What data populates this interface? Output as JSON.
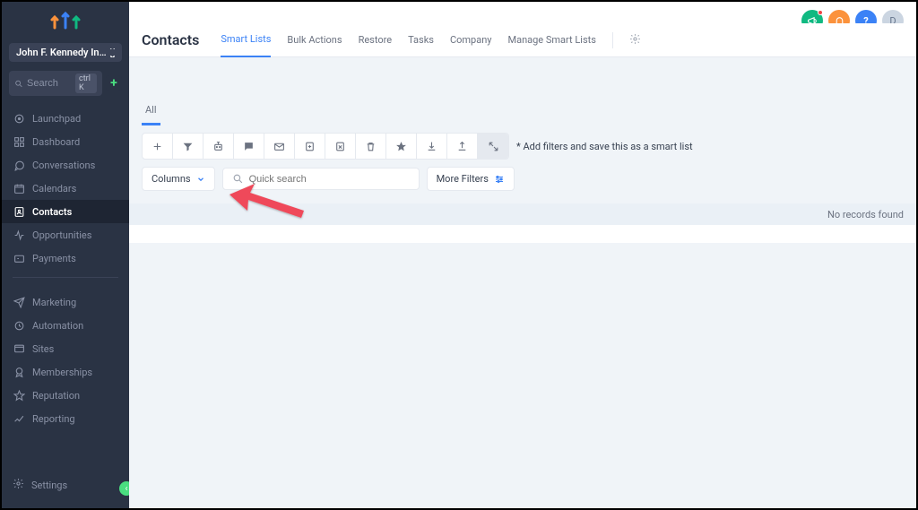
{
  "org": {
    "name": "John F. Kennedy Internati..."
  },
  "search": {
    "placeholder": "Search",
    "kbd": "ctrl K"
  },
  "sidebar": {
    "group1": [
      {
        "label": "Launchpad"
      },
      {
        "label": "Dashboard"
      },
      {
        "label": "Conversations"
      },
      {
        "label": "Calendars"
      },
      {
        "label": "Contacts"
      },
      {
        "label": "Opportunities"
      },
      {
        "label": "Payments"
      }
    ],
    "group2": [
      {
        "label": "Marketing"
      },
      {
        "label": "Automation"
      },
      {
        "label": "Sites"
      },
      {
        "label": "Memberships"
      },
      {
        "label": "Reputation"
      },
      {
        "label": "Reporting"
      }
    ],
    "settings": "Settings"
  },
  "topicons": {
    "avatar_initial": "D"
  },
  "page": {
    "title": "Contacts"
  },
  "subnav": [
    "Smart Lists",
    "Bulk Actions",
    "Restore",
    "Tasks",
    "Company",
    "Manage Smart Lists"
  ],
  "tabs": {
    "all": "All"
  },
  "toolbar": {
    "hint": "* Add filters and save this as a smart list"
  },
  "filters": {
    "columns": "Columns",
    "quick_search_placeholder": "Quick search",
    "more": "More Filters"
  },
  "table": {
    "empty": "No records found"
  }
}
